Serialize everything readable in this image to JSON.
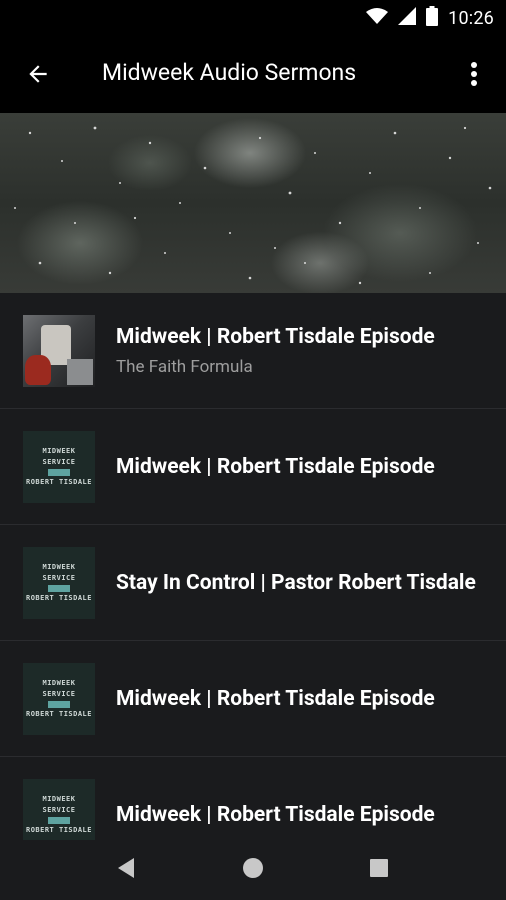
{
  "status": {
    "time": "10:26",
    "icons": [
      "wifi-icon",
      "signal-icon",
      "battery-icon"
    ]
  },
  "appbar": {
    "title": "Midweek Audio Sermons",
    "back_icon": "arrow-back-icon",
    "menu_icon": "more-vert-icon"
  },
  "thumb_text": {
    "line1": "MIDWEEK",
    "line2": "SERVICE",
    "line4": "ROBERT TISDALE"
  },
  "items": [
    {
      "title": "Midweek | Robert Tisdale Episode",
      "subtitle": "The Faith Formula",
      "thumb": "photo"
    },
    {
      "title": "Midweek |  Robert Tisdale Episode",
      "thumb": "art"
    },
    {
      "title": "Stay In Control | Pastor Robert Tisdale",
      "thumb": "art"
    },
    {
      "title": "Midweek | Robert Tisdale Episode",
      "thumb": "art"
    },
    {
      "title": "Midweek | Robert Tisdale Episode",
      "thumb": "art"
    }
  ],
  "navbar": {
    "icons": [
      "back-triangle-icon",
      "home-circle-icon",
      "recents-square-icon"
    ]
  },
  "colors": {
    "background": "#1a1b1d",
    "bar": "#000000",
    "subtitle": "#9e9e9e"
  }
}
